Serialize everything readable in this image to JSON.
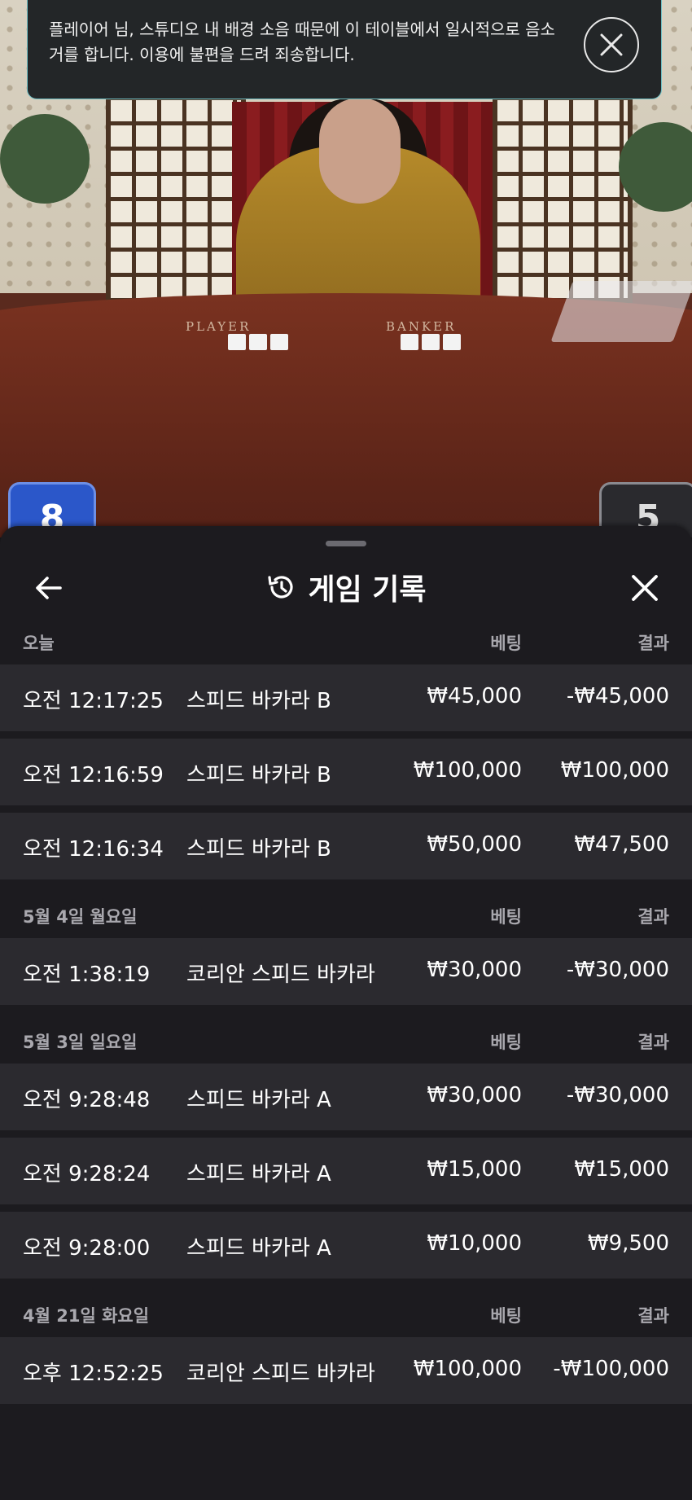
{
  "notification": {
    "message": "플레이어 님, 스튜디오 내 배경 소음 때문에 이 테이블에서 일시적으로 음소거를 합니다. 이용에 불편을 드려 죄송합니다."
  },
  "table": {
    "player_label": "PLAYER",
    "banker_label": "BANKER",
    "player_score": "8",
    "banker_score": "5"
  },
  "panel": {
    "title": "게임 기록",
    "icons": {
      "back": "arrow-left-icon",
      "history": "history-icon",
      "close": "close-icon"
    }
  },
  "groups": [
    {
      "date": "오늘",
      "bet_header": "베팅",
      "result_header": "결과",
      "rows": [
        {
          "time": "오전 12:17:25",
          "game": "스피드 바카라 B",
          "bet": "₩45,000",
          "result": "-₩45,000"
        },
        {
          "time": "오전 12:16:59",
          "game": "스피드 바카라 B",
          "bet": "₩100,000",
          "result": "₩100,000"
        },
        {
          "time": "오전 12:16:34",
          "game": "스피드 바카라 B",
          "bet": "₩50,000",
          "result": "₩47,500"
        }
      ]
    },
    {
      "date": "5월 4일 월요일",
      "bet_header": "베팅",
      "result_header": "결과",
      "rows": [
        {
          "time": "오전 1:38:19",
          "game": "코리안 스피드 바카라",
          "bet": "₩30,000",
          "result": "-₩30,000"
        }
      ]
    },
    {
      "date": "5월 3일 일요일",
      "bet_header": "베팅",
      "result_header": "결과",
      "rows": [
        {
          "time": "오전 9:28:48",
          "game": "스피드 바카라 A",
          "bet": "₩30,000",
          "result": "-₩30,000"
        },
        {
          "time": "오전 9:28:24",
          "game": "스피드 바카라 A",
          "bet": "₩15,000",
          "result": "₩15,000"
        },
        {
          "time": "오전 9:28:00",
          "game": "스피드 바카라 A",
          "bet": "₩10,000",
          "result": "₩9,500"
        }
      ]
    },
    {
      "date": "4월 21일 화요일",
      "bet_header": "베팅",
      "result_header": "결과",
      "rows": [
        {
          "time": "오후 12:52:25",
          "game": "코리안 스피드 바카라",
          "bet": "₩100,000",
          "result": "-₩100,000"
        }
      ]
    }
  ]
}
